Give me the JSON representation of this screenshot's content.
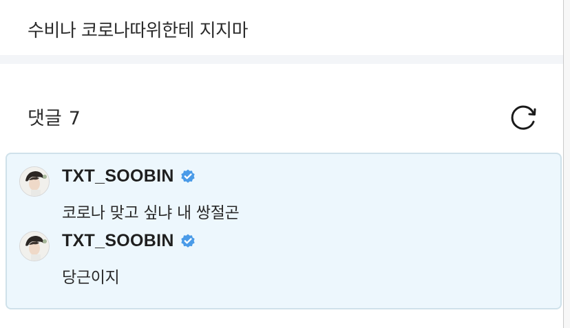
{
  "post": {
    "text": "수비나 코로나따위한테 지지마"
  },
  "comments_section": {
    "label": "댓글",
    "count": "7",
    "refresh_icon": "refresh-icon",
    "colors": {
      "box_background": "#edf7fd",
      "box_border": "#cfe1ea",
      "verified": "#4a9be8"
    },
    "items": [
      {
        "username": "TXT_SOOBIN",
        "verified": true,
        "text": "코로나 맞고 싶냐 내 쌍절곤"
      },
      {
        "username": "TXT_SOOBIN",
        "verified": true,
        "text": "당근이지"
      }
    ]
  }
}
